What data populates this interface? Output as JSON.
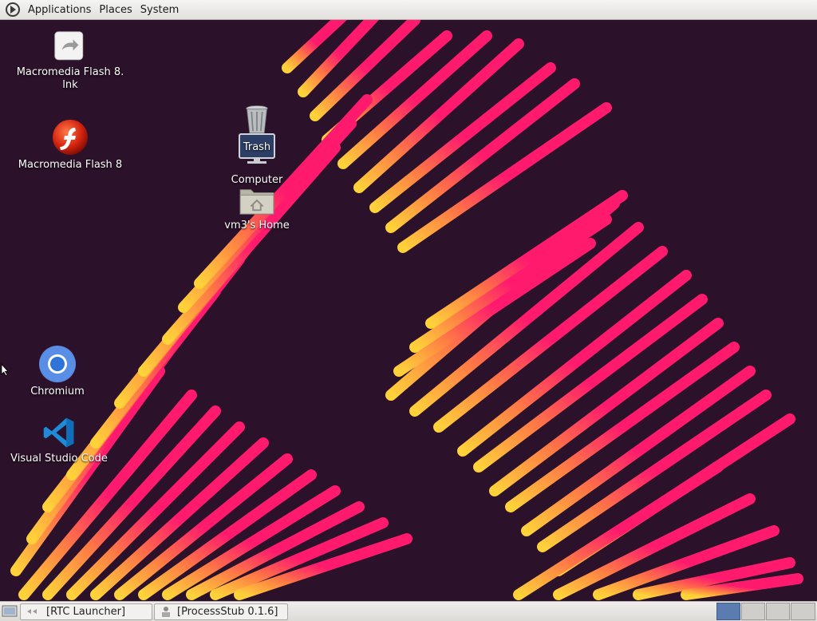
{
  "top_panel": {
    "menus": [
      "Applications",
      "Places",
      "System"
    ]
  },
  "desktop": {
    "icons": {
      "flash_lnk": "Macromedia Flash 8.\nlnk",
      "flash": "Macromedia Flash 8",
      "trash": "Trash",
      "computer": "Computer",
      "home": "vm3's Home",
      "chromium": "Chromium",
      "vscode": "Visual Studio Code"
    }
  },
  "taskbar": {
    "windows": [
      "[RTC Launcher]",
      "[ProcessStub 0.1.6]"
    ],
    "workspaces": 4,
    "active_workspace": 1
  },
  "colors": {
    "wallpaper_bg": "#2b1129",
    "stripe_pink": "#ff1a6e",
    "stripe_orange": "#ff7a45",
    "stripe_yellow": "#ffd23a",
    "active_workspace": "#5a7cb0"
  }
}
